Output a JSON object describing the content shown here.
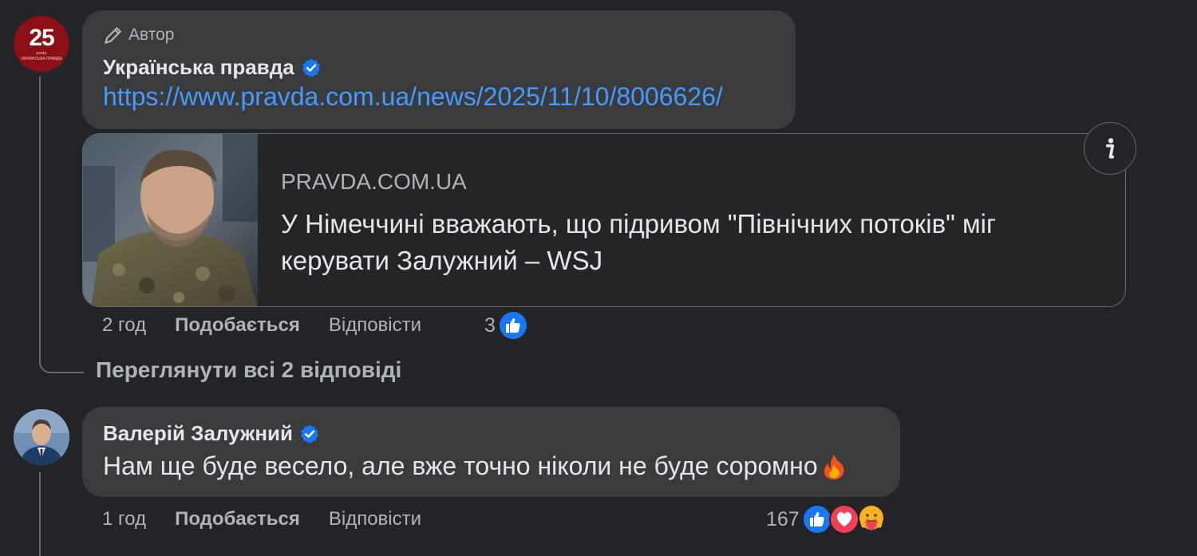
{
  "comment_1": {
    "author_badge": "Автор",
    "author_name": "Українська правда",
    "avatar_number": "25",
    "avatar_sub_1": "років",
    "avatar_sub_2": "УКРАЇНСЬКА ПРАВДА",
    "link": "https://www.pravda.com.ua/news/2025/11/10/8006626/",
    "preview": {
      "domain": "PRAVDA.COM.UA",
      "title": "У Німеччині вважають, що підривом \"Північних потоків\" міг керувати Залужний – WSJ"
    },
    "time": "2 год",
    "like_label": "Подобається",
    "reply_label": "Відповісти",
    "reaction_count": "3"
  },
  "view_replies_label": "Переглянути всі 2 відповіді",
  "comment_2": {
    "author_name": "Валерій Залужний",
    "text": "Нам ще буде весело, але вже точно ніколи не буде соромно",
    "time": "1 год",
    "like_label": "Подобається",
    "reply_label": "Відповісти",
    "reaction_count": "167"
  },
  "colors": {
    "background": "#232427",
    "bubble": "#3a3b3c",
    "link": "#4599ff",
    "verified": "#1877f2",
    "love": "#f33e58",
    "secondary_text": "#b0b3b8"
  }
}
